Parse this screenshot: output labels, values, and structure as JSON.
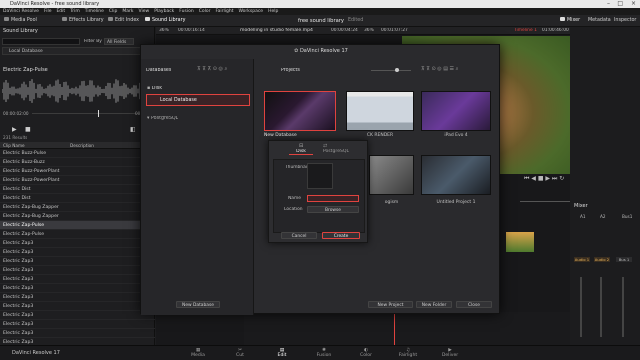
{
  "window": {
    "title": "DaVinci Resolve - free sound library"
  },
  "menu": [
    "DaVinci Resolve",
    "File",
    "Edit",
    "Trim",
    "Timeline",
    "Clip",
    "Mark",
    "View",
    "Playback",
    "Fusion",
    "Color",
    "Fairlight",
    "Workspace",
    "Help"
  ],
  "toolbar": {
    "media_pool": "Media Pool",
    "effects_library": "Effects Library",
    "edit_index": "Edit Index",
    "sound_library": "Sound Library",
    "project_title": "free sound library",
    "edited": "Edited",
    "mixer": "Mixer",
    "metadata": "Metadata",
    "inspector": "Inspector"
  },
  "viewer_bar": {
    "zoom_left": "36%",
    "timecode_left": "00:00:16:14",
    "clip_name": "modelling in studio female.mp4",
    "timecode_mid": "00:00:04:24",
    "zoom_right": "36%",
    "timecode_right": "00:01:07:27",
    "timeline_name": "Timeline 1",
    "timecode_far": "01:00:46:00"
  },
  "sound_library": {
    "title": "Sound Library",
    "filter_label": "Filter By",
    "filter_value": "All Fields",
    "database": "Local Database",
    "selected_clip": "Electric Zap-Pulse",
    "time_start": "00:00:02:00",
    "time_end": "00:01:3",
    "results": "231 Results",
    "col_name": "Clip Name",
    "col_desc": "Description",
    "items": [
      "Electric Buzz-Pulse",
      "Electric Buzz-Buzz",
      "Electric Buzz-PowerPlant",
      "Electric Buzz-PowerPlant",
      "Electric Dist",
      "Electric Dist",
      "Electric Zap-Bug Zapper",
      "Electric Zap-Bug Zapper",
      "Electric Zap-Pulse",
      "Electric Zap-Pulse",
      "Electric Zap3",
      "Electric Zap3",
      "Electric Zap3",
      "Electric Zap3",
      "Electric Zap3",
      "Electric Zap3",
      "Electric Zap3",
      "Electric Zap3",
      "Electric Zap3",
      "Electric Zap3",
      "Electric Zap3",
      "Electric Zap3"
    ]
  },
  "project_manager": {
    "title": "DaVinci Resolve 17",
    "databases_label": "Databases",
    "projects_label": "Projects",
    "disk_label": "Disk",
    "local_db": "Local Database",
    "postgres_label": "PostgreSQL",
    "new_database": "New Database",
    "new_project": "New Project",
    "new_folder": "New Folder",
    "close": "Close",
    "projects": [
      {
        "name": "New Database"
      },
      {
        "name": "CK RENDER"
      },
      {
        "name": "iPad Evo 4"
      },
      {
        "name": "ogism"
      },
      {
        "name": "Untitled Project 1"
      }
    ]
  },
  "new_db_dialog": {
    "tab_disk": "Disk",
    "tab_postgres": "PostgreSQL",
    "thumbnail_label": "Thumbnail",
    "name_label": "Name",
    "location_label": "Location",
    "browse": "Browse",
    "cancel": "Cancel",
    "create": "Create"
  },
  "mixer": {
    "title": "Mixer",
    "channels": [
      "A1",
      "A2",
      "Bus1"
    ],
    "levels": [
      "0.0",
      "0.0",
      "0.0"
    ],
    "tracks": [
      "Audio 1",
      "Audio 2",
      "Bus 1"
    ]
  },
  "pages": [
    "Media",
    "Cut",
    "Edit",
    "Fusion",
    "Color",
    "Fairlight",
    "Deliver"
  ],
  "app_label": "DaVinci Resolve 17",
  "colors": {
    "accent_red": "#e0433f",
    "selection": "#4a2a2a"
  }
}
